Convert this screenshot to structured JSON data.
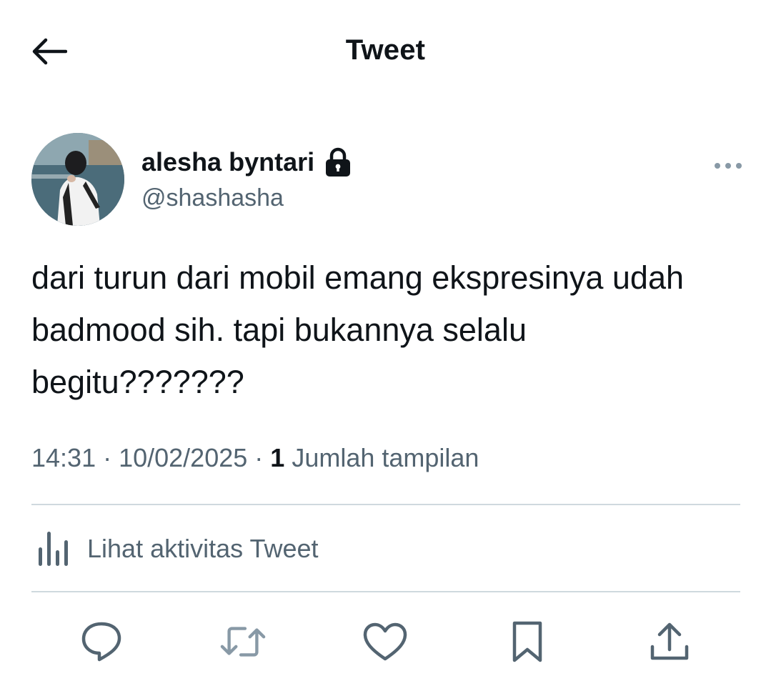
{
  "header": {
    "title": "Tweet",
    "back_icon": "arrow-left-icon"
  },
  "author": {
    "display_name": "alesha byntari",
    "handle": "@shashasha",
    "protected_icon": "lock-icon",
    "more_icon": "more-horizontal-icon"
  },
  "tweet": {
    "text": "dari turun dari mobil emang ekspresinya udah badmood sih. tapi bukannya selalu begitu???????",
    "time": "14:31",
    "separator": " · ",
    "date": "10/02/2025",
    "views_count": "1",
    "views_label": "Jumlah tampilan"
  },
  "activity": {
    "label": "Lihat aktivitas Tweet",
    "icon": "bar-chart-icon"
  },
  "actions": {
    "reply_icon": "reply-icon",
    "retweet_icon": "retweet-icon",
    "like_icon": "heart-icon",
    "bookmark_icon": "bookmark-icon",
    "share_icon": "share-icon"
  },
  "colors": {
    "text": "#0f1419",
    "secondary": "#536471",
    "divider": "#cfd9de",
    "retweet_icon": "#8899a6"
  }
}
